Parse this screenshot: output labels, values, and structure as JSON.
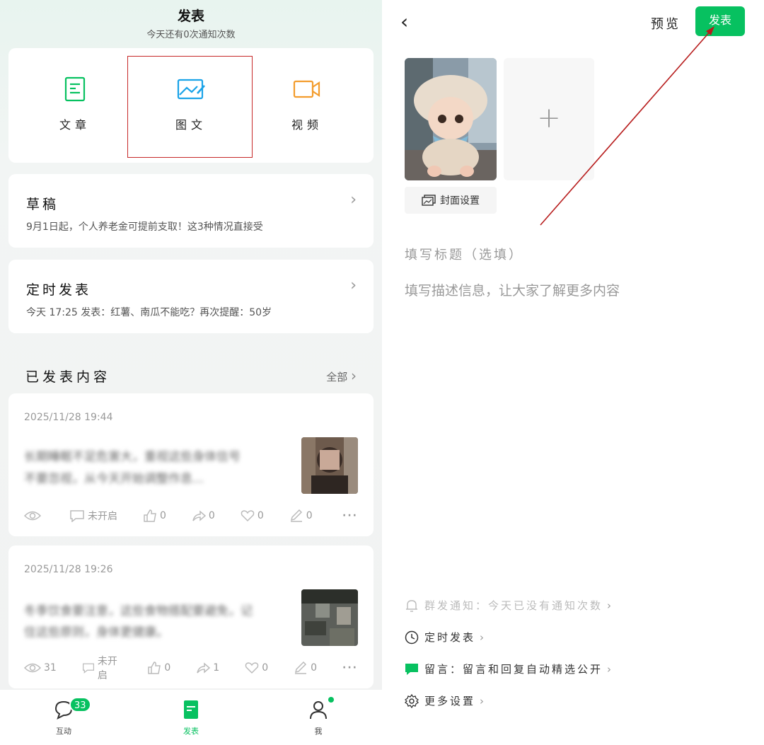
{
  "left": {
    "header": {
      "title": "发表",
      "subtitle": "今天还有0次通知次数"
    },
    "types": [
      {
        "label": "文章",
        "icon": "article-icon",
        "color": "#07c160"
      },
      {
        "label": "图文",
        "icon": "image-text-icon",
        "color": "#1aa3e8"
      },
      {
        "label": "视频",
        "icon": "video-icon",
        "color": "#f39c2c"
      }
    ],
    "drafts": {
      "title": "草稿",
      "subtitle": "9月1日起，个人养老金可提前支取！这3种情况直接受"
    },
    "scheduled": {
      "title": "定时发表",
      "subtitle": "今天 17:25 发表：红薯、南瓜不能吃？再次提醒：50岁"
    },
    "published": {
      "title": "已发表内容",
      "all_label": "全部"
    },
    "posts": [
      {
        "date": "2025/11/28 19:44",
        "line1": "长期睡眠不足危害大，重视这些身体信号",
        "line2": "不要忽视，从今天开始调整作息...",
        "views": "",
        "comments": "未开启",
        "likes": "0",
        "shares": "0",
        "favorites": "0",
        "edits": "0"
      },
      {
        "date": "2025/11/28 19:26",
        "line1": "冬季饮食要注意，这些食物搭配要避免，记",
        "line2": "住这些原则，身体更健康。",
        "views": "31",
        "comments": "未开启",
        "likes": "0",
        "shares": "1",
        "favorites": "0",
        "edits": "0"
      }
    ],
    "tabbar": [
      {
        "label": "互动",
        "badge": "33"
      },
      {
        "label": "发表"
      },
      {
        "label": "我"
      }
    ]
  },
  "right": {
    "preview_label": "预览",
    "publish_label": "发表",
    "cover_label": "封面设置",
    "title_placeholder": "填写标题（选填）",
    "desc_placeholder": "填写描述信息，让大家了解更多内容",
    "settings": [
      {
        "label": "群发通知：今天已没有通知次数",
        "icon": "bell-icon"
      },
      {
        "label": "定时发表",
        "icon": "clock-icon"
      },
      {
        "label": "留言：留言和回复自动精选公开",
        "icon": "comment-icon"
      },
      {
        "label": "更多设置",
        "icon": "gear-icon"
      }
    ]
  },
  "colors": {
    "accent": "#07c160",
    "highlight": "#c62828"
  }
}
